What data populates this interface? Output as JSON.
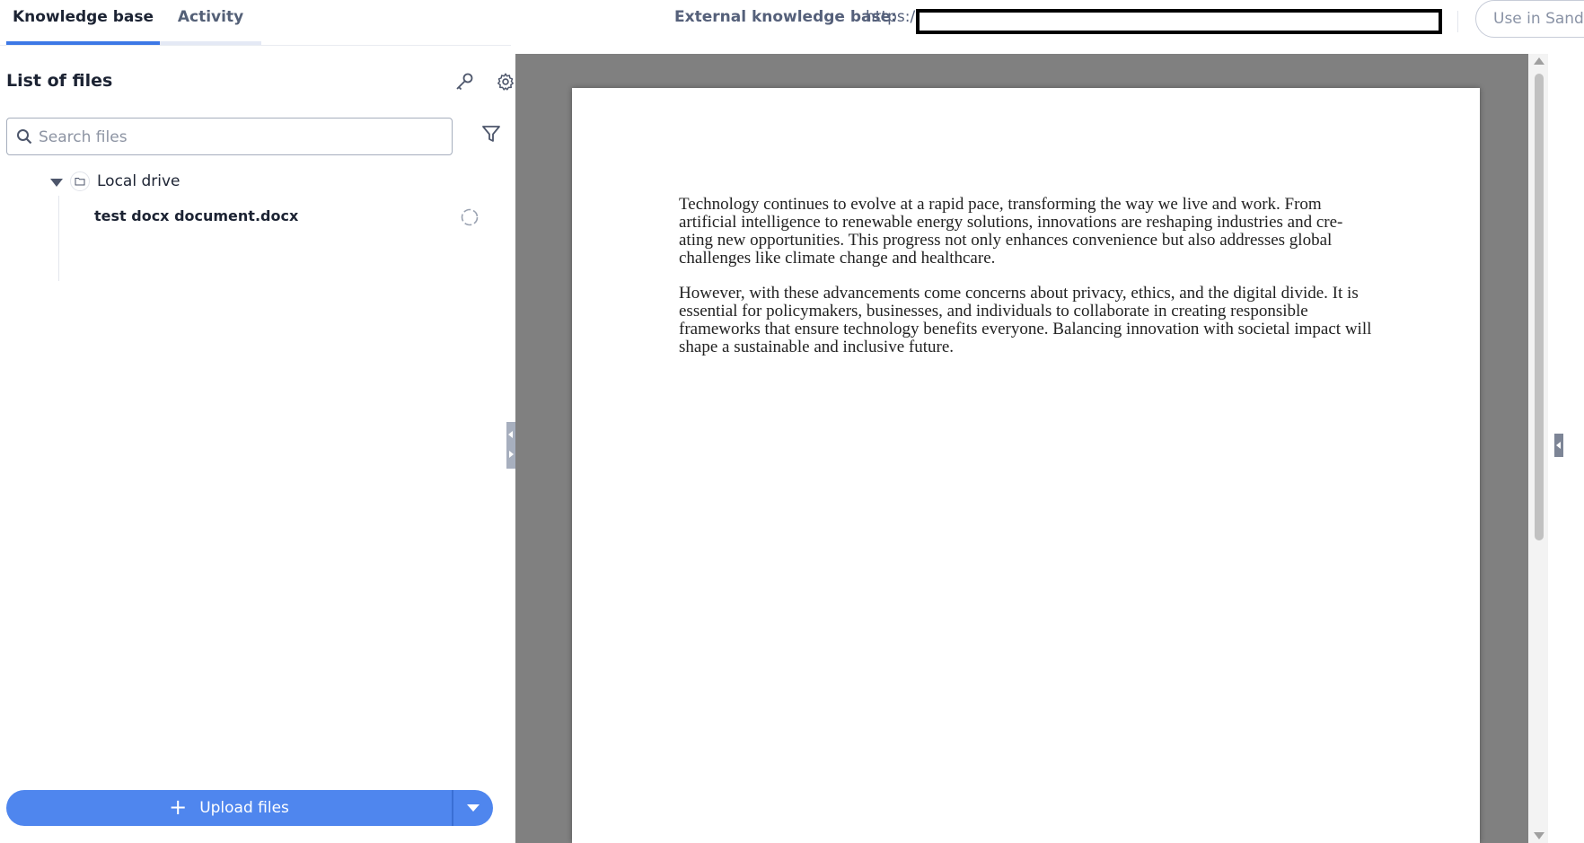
{
  "tabs": [
    {
      "label": "Knowledge base",
      "active": true
    },
    {
      "label": "Activity",
      "active": false
    }
  ],
  "header": {
    "external_label": "External knowledge base:",
    "external_url_prefix": "https:/",
    "sandbox_button": "Use in Sandb"
  },
  "sidebar": {
    "title": "List of files",
    "icons": [
      "key-icon",
      "gear-icon",
      "filter-icon"
    ],
    "search": {
      "placeholder": "Search files",
      "value": ""
    },
    "tree": {
      "folder_label": "Local drive",
      "files": [
        {
          "name": "test docx document.docx",
          "status": "processing"
        }
      ]
    },
    "upload_button": "Upload files"
  },
  "document": {
    "paragraphs": [
      "Technology continues to evolve at a rapid pace, transforming the way we live and work. From artificial intelligence to renewable energy solutions, innovations are reshaping industries and cre-ating new opportunities. This progress not only enhances convenience but also addresses global challenges like climate change and healthcare.",
      "However, with these advancements come concerns about privacy, ethics, and the digital divide. It is essential for policymakers, businesses, and individuals to collaborate in creating responsible frameworks that ensure technology benefits everyone. Balancing innovation with societal impact will shape a sustainable and inclusive future."
    ]
  },
  "colors": {
    "accent": "#4f86ee",
    "tab_active_underline": "#3d78e6",
    "viewer_background": "#808080"
  }
}
